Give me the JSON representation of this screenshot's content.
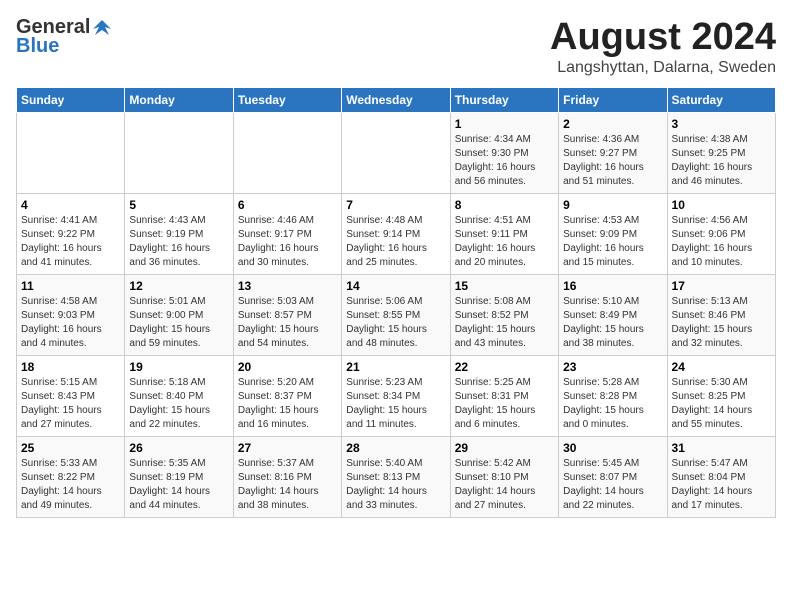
{
  "header": {
    "logo_general": "General",
    "logo_blue": "Blue",
    "title": "August 2024",
    "subtitle": "Langshyttan, Dalarna, Sweden"
  },
  "weekdays": [
    "Sunday",
    "Monday",
    "Tuesday",
    "Wednesday",
    "Thursday",
    "Friday",
    "Saturday"
  ],
  "weeks": [
    [
      {
        "day": "",
        "detail": ""
      },
      {
        "day": "",
        "detail": ""
      },
      {
        "day": "",
        "detail": ""
      },
      {
        "day": "",
        "detail": ""
      },
      {
        "day": "1",
        "detail": "Sunrise: 4:34 AM\nSunset: 9:30 PM\nDaylight: 16 hours\nand 56 minutes."
      },
      {
        "day": "2",
        "detail": "Sunrise: 4:36 AM\nSunset: 9:27 PM\nDaylight: 16 hours\nand 51 minutes."
      },
      {
        "day": "3",
        "detail": "Sunrise: 4:38 AM\nSunset: 9:25 PM\nDaylight: 16 hours\nand 46 minutes."
      }
    ],
    [
      {
        "day": "4",
        "detail": "Sunrise: 4:41 AM\nSunset: 9:22 PM\nDaylight: 16 hours\nand 41 minutes."
      },
      {
        "day": "5",
        "detail": "Sunrise: 4:43 AM\nSunset: 9:19 PM\nDaylight: 16 hours\nand 36 minutes."
      },
      {
        "day": "6",
        "detail": "Sunrise: 4:46 AM\nSunset: 9:17 PM\nDaylight: 16 hours\nand 30 minutes."
      },
      {
        "day": "7",
        "detail": "Sunrise: 4:48 AM\nSunset: 9:14 PM\nDaylight: 16 hours\nand 25 minutes."
      },
      {
        "day": "8",
        "detail": "Sunrise: 4:51 AM\nSunset: 9:11 PM\nDaylight: 16 hours\nand 20 minutes."
      },
      {
        "day": "9",
        "detail": "Sunrise: 4:53 AM\nSunset: 9:09 PM\nDaylight: 16 hours\nand 15 minutes."
      },
      {
        "day": "10",
        "detail": "Sunrise: 4:56 AM\nSunset: 9:06 PM\nDaylight: 16 hours\nand 10 minutes."
      }
    ],
    [
      {
        "day": "11",
        "detail": "Sunrise: 4:58 AM\nSunset: 9:03 PM\nDaylight: 16 hours\nand 4 minutes."
      },
      {
        "day": "12",
        "detail": "Sunrise: 5:01 AM\nSunset: 9:00 PM\nDaylight: 15 hours\nand 59 minutes."
      },
      {
        "day": "13",
        "detail": "Sunrise: 5:03 AM\nSunset: 8:57 PM\nDaylight: 15 hours\nand 54 minutes."
      },
      {
        "day": "14",
        "detail": "Sunrise: 5:06 AM\nSunset: 8:55 PM\nDaylight: 15 hours\nand 48 minutes."
      },
      {
        "day": "15",
        "detail": "Sunrise: 5:08 AM\nSunset: 8:52 PM\nDaylight: 15 hours\nand 43 minutes."
      },
      {
        "day": "16",
        "detail": "Sunrise: 5:10 AM\nSunset: 8:49 PM\nDaylight: 15 hours\nand 38 minutes."
      },
      {
        "day": "17",
        "detail": "Sunrise: 5:13 AM\nSunset: 8:46 PM\nDaylight: 15 hours\nand 32 minutes."
      }
    ],
    [
      {
        "day": "18",
        "detail": "Sunrise: 5:15 AM\nSunset: 8:43 PM\nDaylight: 15 hours\nand 27 minutes."
      },
      {
        "day": "19",
        "detail": "Sunrise: 5:18 AM\nSunset: 8:40 PM\nDaylight: 15 hours\nand 22 minutes."
      },
      {
        "day": "20",
        "detail": "Sunrise: 5:20 AM\nSunset: 8:37 PM\nDaylight: 15 hours\nand 16 minutes."
      },
      {
        "day": "21",
        "detail": "Sunrise: 5:23 AM\nSunset: 8:34 PM\nDaylight: 15 hours\nand 11 minutes."
      },
      {
        "day": "22",
        "detail": "Sunrise: 5:25 AM\nSunset: 8:31 PM\nDaylight: 15 hours\nand 6 minutes."
      },
      {
        "day": "23",
        "detail": "Sunrise: 5:28 AM\nSunset: 8:28 PM\nDaylight: 15 hours\nand 0 minutes."
      },
      {
        "day": "24",
        "detail": "Sunrise: 5:30 AM\nSunset: 8:25 PM\nDaylight: 14 hours\nand 55 minutes."
      }
    ],
    [
      {
        "day": "25",
        "detail": "Sunrise: 5:33 AM\nSunset: 8:22 PM\nDaylight: 14 hours\nand 49 minutes."
      },
      {
        "day": "26",
        "detail": "Sunrise: 5:35 AM\nSunset: 8:19 PM\nDaylight: 14 hours\nand 44 minutes."
      },
      {
        "day": "27",
        "detail": "Sunrise: 5:37 AM\nSunset: 8:16 PM\nDaylight: 14 hours\nand 38 minutes."
      },
      {
        "day": "28",
        "detail": "Sunrise: 5:40 AM\nSunset: 8:13 PM\nDaylight: 14 hours\nand 33 minutes."
      },
      {
        "day": "29",
        "detail": "Sunrise: 5:42 AM\nSunset: 8:10 PM\nDaylight: 14 hours\nand 27 minutes."
      },
      {
        "day": "30",
        "detail": "Sunrise: 5:45 AM\nSunset: 8:07 PM\nDaylight: 14 hours\nand 22 minutes."
      },
      {
        "day": "31",
        "detail": "Sunrise: 5:47 AM\nSunset: 8:04 PM\nDaylight: 14 hours\nand 17 minutes."
      }
    ]
  ]
}
